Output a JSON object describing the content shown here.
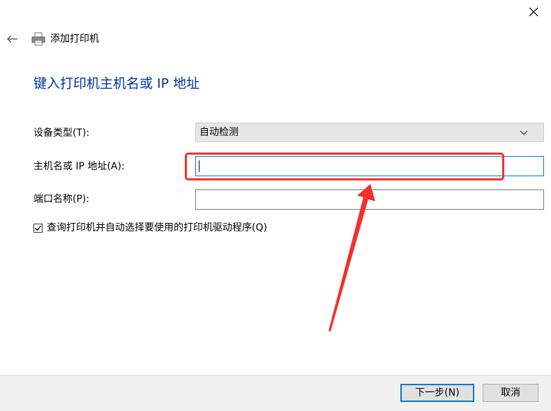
{
  "window": {
    "title": "添加打印机"
  },
  "icons": {
    "close": "close-icon",
    "back": "back-arrow-icon",
    "printer": "printer-icon",
    "dropdown": "chevron-down-icon",
    "checkbox": "checkmark-icon"
  },
  "heading": "键入打印机主机名或 IP 地址",
  "form": {
    "device_type": {
      "label": "设备类型(T):",
      "value": "自动检测"
    },
    "host": {
      "label": "主机名或 IP 地址(A):",
      "value": ""
    },
    "port": {
      "label": "端口名称(P):",
      "value": ""
    },
    "query_printer": {
      "label": "查询打印机并自动选择要使用的打印机驱动程序(Q)",
      "checked": true
    }
  },
  "buttons": {
    "next": "下一步(N)",
    "cancel": "取消"
  },
  "colors": {
    "heading": "#003399",
    "annotation": "#f2302c",
    "focus": "#0078d7"
  }
}
